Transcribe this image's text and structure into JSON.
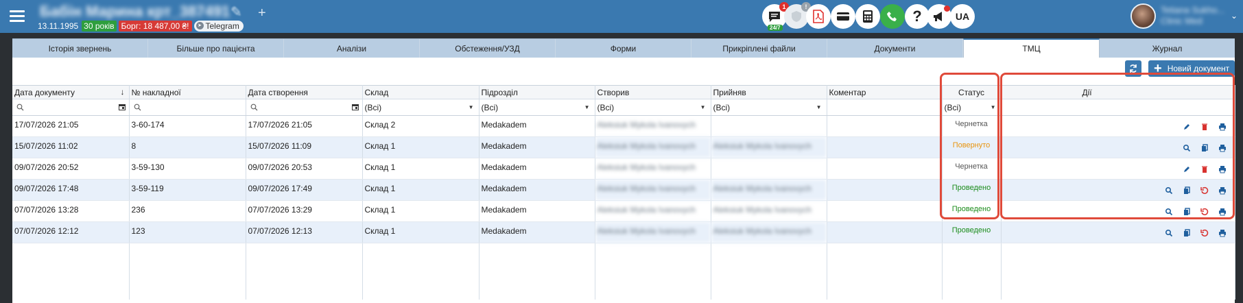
{
  "header": {
    "patient_name": "Бабін Марина крт_387491",
    "dob": "13.11.1995",
    "age": "30 років",
    "debt": "Борг: 18 487,00 ₴!",
    "telegram": "Telegram",
    "lang": "UA",
    "user_name": "Tetiana Sukho...",
    "user_role": "Clinic Med",
    "chat_badge": "1",
    "chat_sub": "24/7",
    "warn_badge": "!",
    "help": "?"
  },
  "tabs": [
    {
      "label": "Історія звернень"
    },
    {
      "label": "Більше про пацієнта"
    },
    {
      "label": "Аналізи"
    },
    {
      "label": "Обстеження/УЗД"
    },
    {
      "label": "Форми"
    },
    {
      "label": "Прикріплені файли"
    },
    {
      "label": "Документи"
    },
    {
      "label": "ТМЦ",
      "active": true
    },
    {
      "label": "Журнал"
    }
  ],
  "toolbar": {
    "new_doc_label": "Новий документ"
  },
  "table": {
    "columns": [
      "Дата документу",
      "№ накладної",
      "Дата створення",
      "Склад",
      "Підрозділ",
      "Створив",
      "Прийняв",
      "Коментар",
      "Статус",
      "Дії"
    ],
    "filter_all": "(Всі)",
    "rows": [
      {
        "doc_date": "17/07/2026 21:05",
        "invoice": "3-60-174",
        "created": "17/07/2026 21:05",
        "warehouse": "Склад 2",
        "dept": "Medakadem",
        "creator": "Aleksiuk Mykola Ivanovych",
        "receiver": "",
        "comment": "",
        "status": "Чернетка",
        "status_class": "st-draft",
        "actions": [
          "edit-icon",
          "delete-icon",
          "print-icon"
        ]
      },
      {
        "doc_date": "15/07/2026 11:02",
        "invoice": "8",
        "created": "15/07/2026 11:09",
        "warehouse": "Склад 1",
        "dept": "Medakadem",
        "creator": "Aleksiuk Mykola Ivanovych",
        "receiver": "Aleksiuk Mykola Ivanovych",
        "comment": "",
        "status": "Повернуто",
        "status_class": "st-returned",
        "actions": [
          "view-icon",
          "copy-icon",
          "print-icon"
        ]
      },
      {
        "doc_date": "09/07/2026 20:52",
        "invoice": "3-59-130",
        "created": "09/07/2026 20:53",
        "warehouse": "Склад 1",
        "dept": "Medakadem",
        "creator": "Aleksiuk Mykola Ivanovych",
        "receiver": "",
        "comment": "",
        "status": "Чернетка",
        "status_class": "st-draft",
        "actions": [
          "edit-icon",
          "delete-icon",
          "print-icon"
        ]
      },
      {
        "doc_date": "09/07/2026 17:48",
        "invoice": "3-59-119",
        "created": "09/07/2026 17:49",
        "warehouse": "Склад 1",
        "dept": "Medakadem",
        "creator": "Aleksiuk Mykola Ivanovych",
        "receiver": "Aleksiuk Mykola Ivanovych",
        "comment": "",
        "status": "Проведено",
        "status_class": "st-done",
        "actions": [
          "view-icon",
          "copy-icon",
          "undo-icon",
          "print-icon"
        ]
      },
      {
        "doc_date": "07/07/2026 13:28",
        "invoice": "236",
        "created": "07/07/2026 13:29",
        "warehouse": "Склад 1",
        "dept": "Medakadem",
        "creator": "Aleksiuk Mykola Ivanovych",
        "receiver": "Aleksiuk Mykola Ivanovych",
        "comment": "",
        "status": "Проведено",
        "status_class": "st-done",
        "actions": [
          "view-icon",
          "copy-icon",
          "undo-icon",
          "print-icon"
        ]
      },
      {
        "doc_date": "07/07/2026 12:12",
        "invoice": "123",
        "created": "07/07/2026 12:13",
        "warehouse": "Склад 1",
        "dept": "Medakadem",
        "creator": "Aleksiuk Mykola Ivanovych",
        "receiver": "Aleksiuk Mykola Ivanovych",
        "comment": "",
        "status": "Проведено",
        "status_class": "st-done",
        "actions": [
          "view-icon",
          "copy-icon",
          "undo-icon",
          "print-icon"
        ]
      }
    ]
  },
  "colors": {
    "brand": "#3a79b0",
    "status_draft": "#555555",
    "status_returned": "#e8940e",
    "status_done": "#1c8c1c",
    "highlight": "#e04a3a"
  }
}
